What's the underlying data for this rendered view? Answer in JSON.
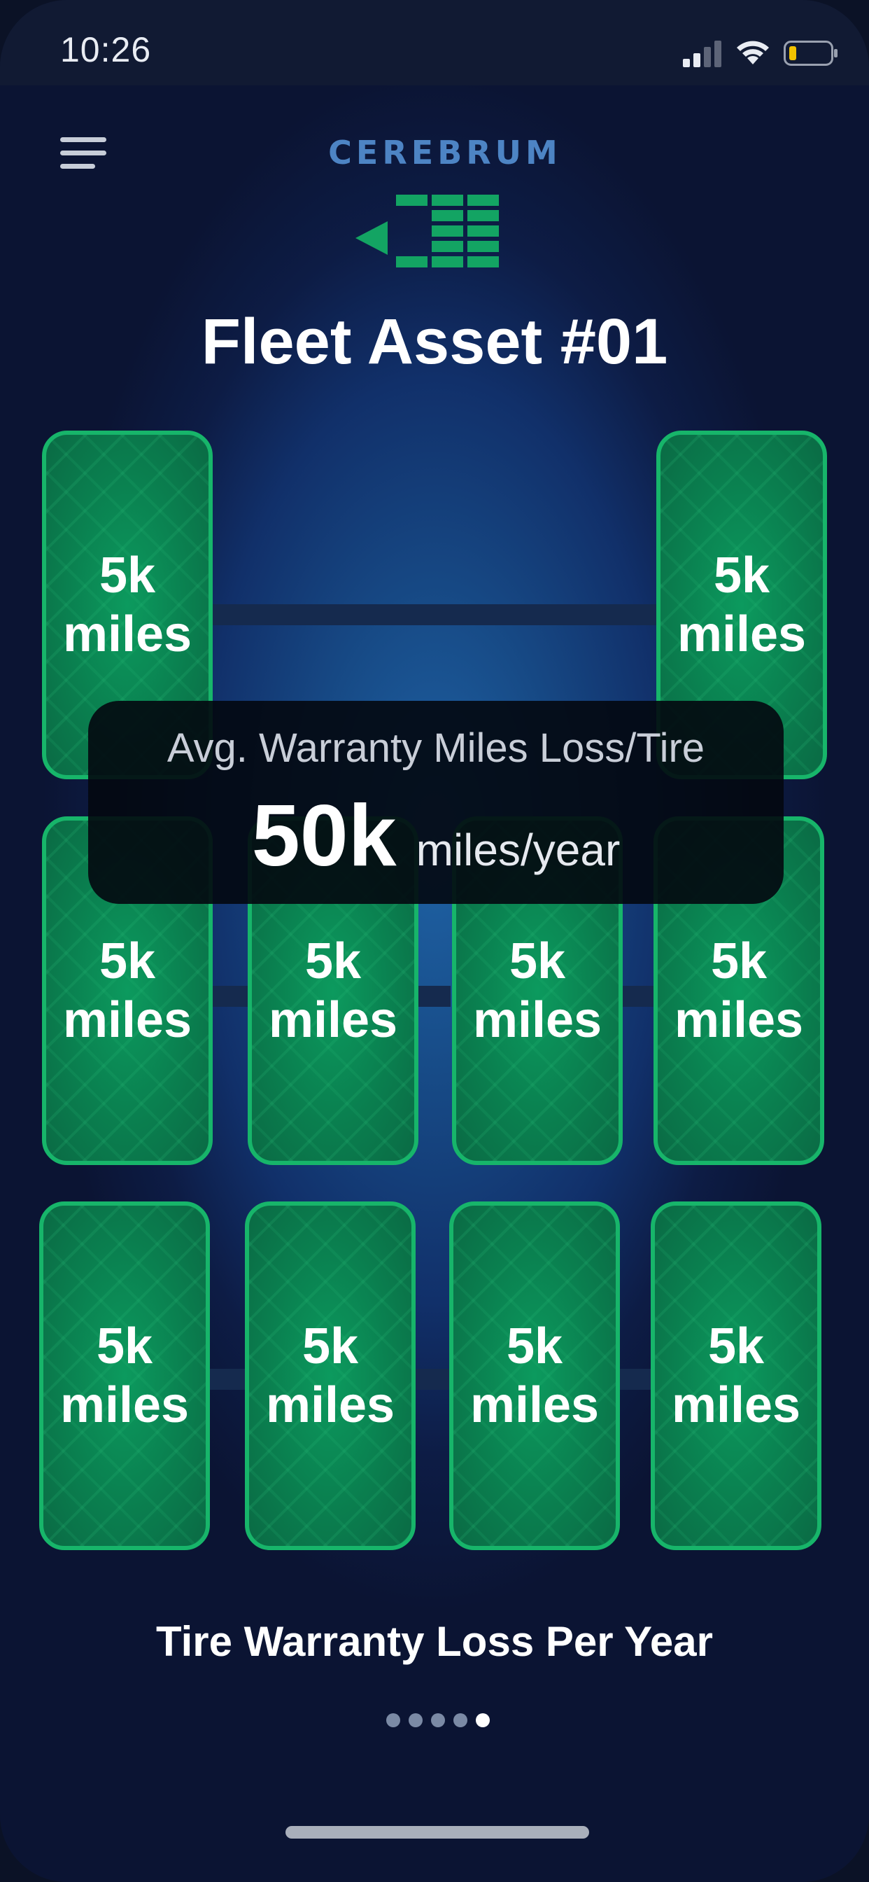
{
  "status_bar": {
    "time": "10:26"
  },
  "header": {
    "brand": "CEREBRUM",
    "title": "Fleet Asset #01"
  },
  "tires": [
    {
      "id": "front-left",
      "value": "5k\nmiles"
    },
    {
      "id": "front-right",
      "value": "5k\nmiles"
    },
    {
      "id": "mid-1",
      "value": "5k\nmiles"
    },
    {
      "id": "mid-2",
      "value": "5k\nmiles"
    },
    {
      "id": "mid-3",
      "value": "5k\nmiles"
    },
    {
      "id": "mid-4",
      "value": "5k\nmiles"
    },
    {
      "id": "rear-1",
      "value": "5k\nmiles"
    },
    {
      "id": "rear-2",
      "value": "5k\nmiles"
    },
    {
      "id": "rear-3",
      "value": "5k\nmiles"
    },
    {
      "id": "rear-4",
      "value": "5k\nmiles"
    }
  ],
  "stat": {
    "label": "Avg. Warranty Miles Loss/Tire",
    "value": "50k",
    "unit": "miles/year"
  },
  "footer": {
    "caption": "Tire Warranty Loss Per Year",
    "pager_total": 5,
    "pager_active": 5
  },
  "colors": {
    "accent_green": "#17b56a",
    "brand_blue": "#4d84c4",
    "background": "#0b1433"
  }
}
